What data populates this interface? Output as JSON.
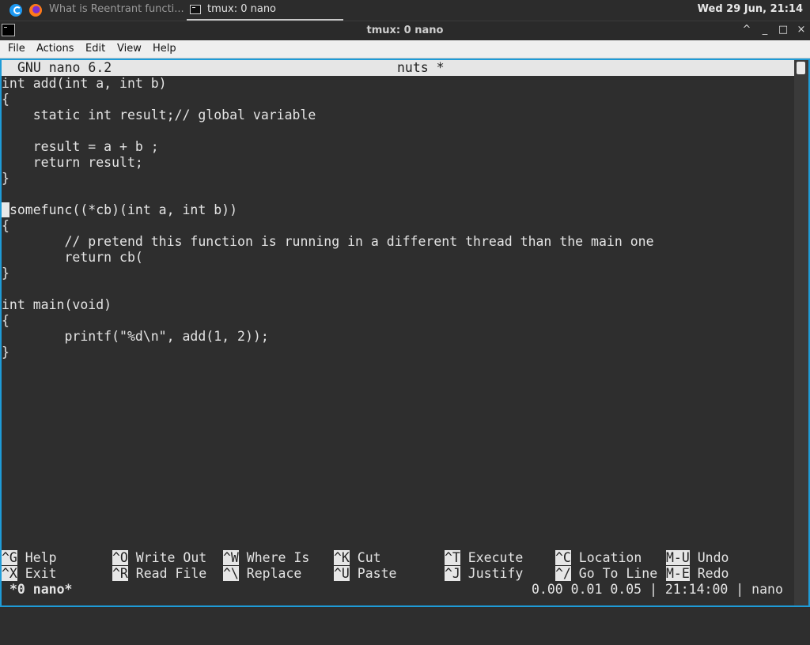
{
  "panel": {
    "taskbar_item_browser": "What is Reentrant functi...",
    "taskbar_item_terminal": "tmux: 0 nano",
    "clock": "Wed 29 Jun, 21:14"
  },
  "window": {
    "title": "tmux: 0 nano",
    "controls": {
      "shade": "^",
      "minimize": "_",
      "maximize": "□",
      "close": "×"
    }
  },
  "menubar": {
    "items": [
      "File",
      "Actions",
      "Edit",
      "View",
      "Help"
    ]
  },
  "nano": {
    "version": "GNU nano 6.2",
    "filename": "nuts *",
    "lines": [
      "int add(int a, int b)",
      "{",
      "    static int result;// global variable",
      "",
      "    result = a + b ;",
      "    return result;",
      "}",
      "",
      "somefunc((*cb)(int a, int b))",
      "{",
      "        // pretend this function is running in a different thread than the main one",
      "        return cb(",
      "}",
      "",
      "int main(void)",
      "{",
      "        printf(\"%d\\n\", add(1, 2));",
      "}"
    ],
    "cursor_line": 8,
    "shortcuts_row1": [
      {
        "key": "^G",
        "label": "Help"
      },
      {
        "key": "^O",
        "label": "Write Out"
      },
      {
        "key": "^W",
        "label": "Where Is"
      },
      {
        "key": "^K",
        "label": "Cut"
      },
      {
        "key": "^T",
        "label": "Execute"
      },
      {
        "key": "^C",
        "label": "Location"
      },
      {
        "key": "M-U",
        "label": "Undo"
      }
    ],
    "shortcuts_row2": [
      {
        "key": "^X",
        "label": "Exit"
      },
      {
        "key": "^R",
        "label": "Read File"
      },
      {
        "key": "^\\",
        "label": "Replace"
      },
      {
        "key": "^U",
        "label": "Paste"
      },
      {
        "key": "^J",
        "label": "Justify"
      },
      {
        "key": "^/",
        "label": "Go To Line"
      },
      {
        "key": "M-E",
        "label": "Redo"
      }
    ]
  },
  "tmux": {
    "window_label": "*0 nano*",
    "status_right": "0.00 0.01 0.05 | 21:14:00 | nano"
  },
  "icons": {
    "distro": "distro-logo-icon",
    "browser": "firefox-icon",
    "terminal": "terminal-icon"
  }
}
